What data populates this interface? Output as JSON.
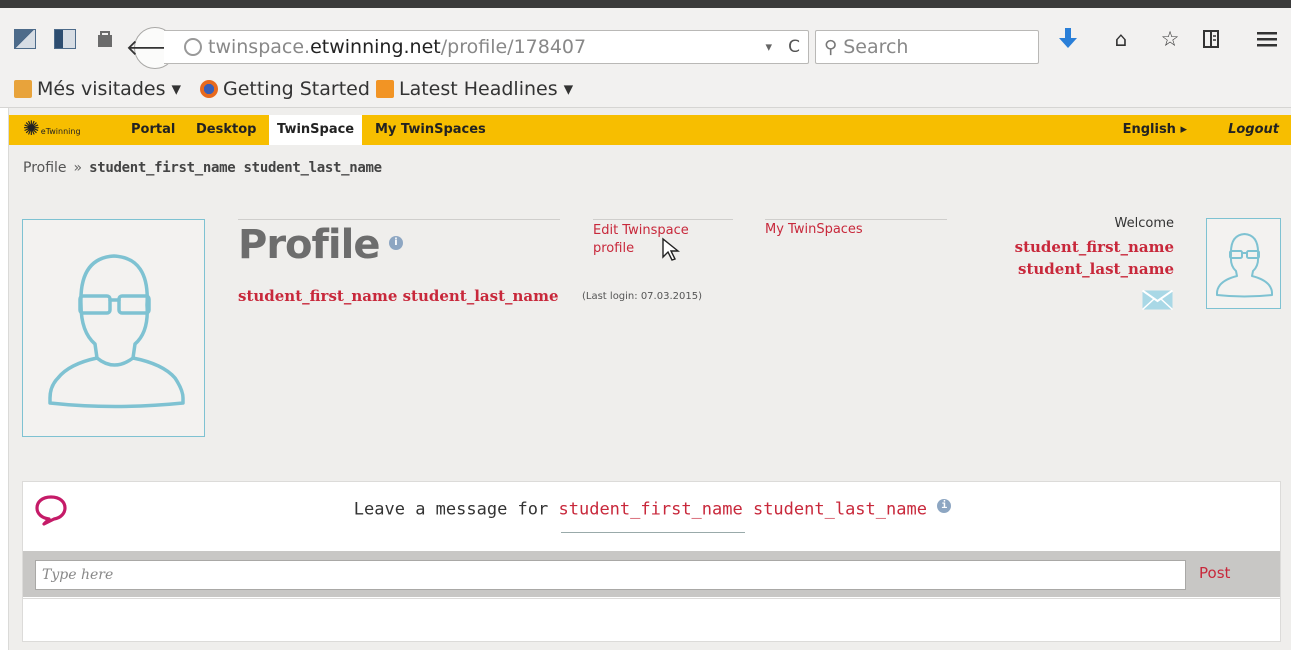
{
  "browser": {
    "url_host": "twinspace.",
    "url_domain": "etwinning.net",
    "url_path": "/profile/178407",
    "search_placeholder": "Search",
    "url_dropdown": "▾",
    "reload_glyph": "C"
  },
  "bookmarks": [
    {
      "label": "Més visitades ▾"
    },
    {
      "label": "Getting Started"
    },
    {
      "label": "Latest Headlines ▾"
    }
  ],
  "nav": {
    "logo_label": "eTwinning",
    "items": [
      "Portal",
      "Desktop",
      "TwinSpace",
      "My TwinSpaces"
    ],
    "language": "English ▸",
    "logout": "Logout"
  },
  "breadcrumb": {
    "root": "Profile",
    "separator": "»",
    "current": "student_first_name student_last_name"
  },
  "profile": {
    "title": "Profile",
    "name": "student_first_name student_last_name",
    "last_login": "(Last login: 07.03.2015)",
    "edit_link": "Edit Twinspace profile",
    "my_twinspaces_link": "My TwinSpaces",
    "welcome": "Welcome",
    "welcome_first": "student_first_name",
    "welcome_last": "student_last_name"
  },
  "message": {
    "heading_prefix": "Leave a message for",
    "heading_name": "student_first_name student_last_name",
    "input_placeholder": "Type here",
    "post_label": "Post"
  },
  "colors": {
    "nav_bg": "#f7be00",
    "accent_red": "#c8283b",
    "avatar_blue": "#7ec2d2"
  }
}
